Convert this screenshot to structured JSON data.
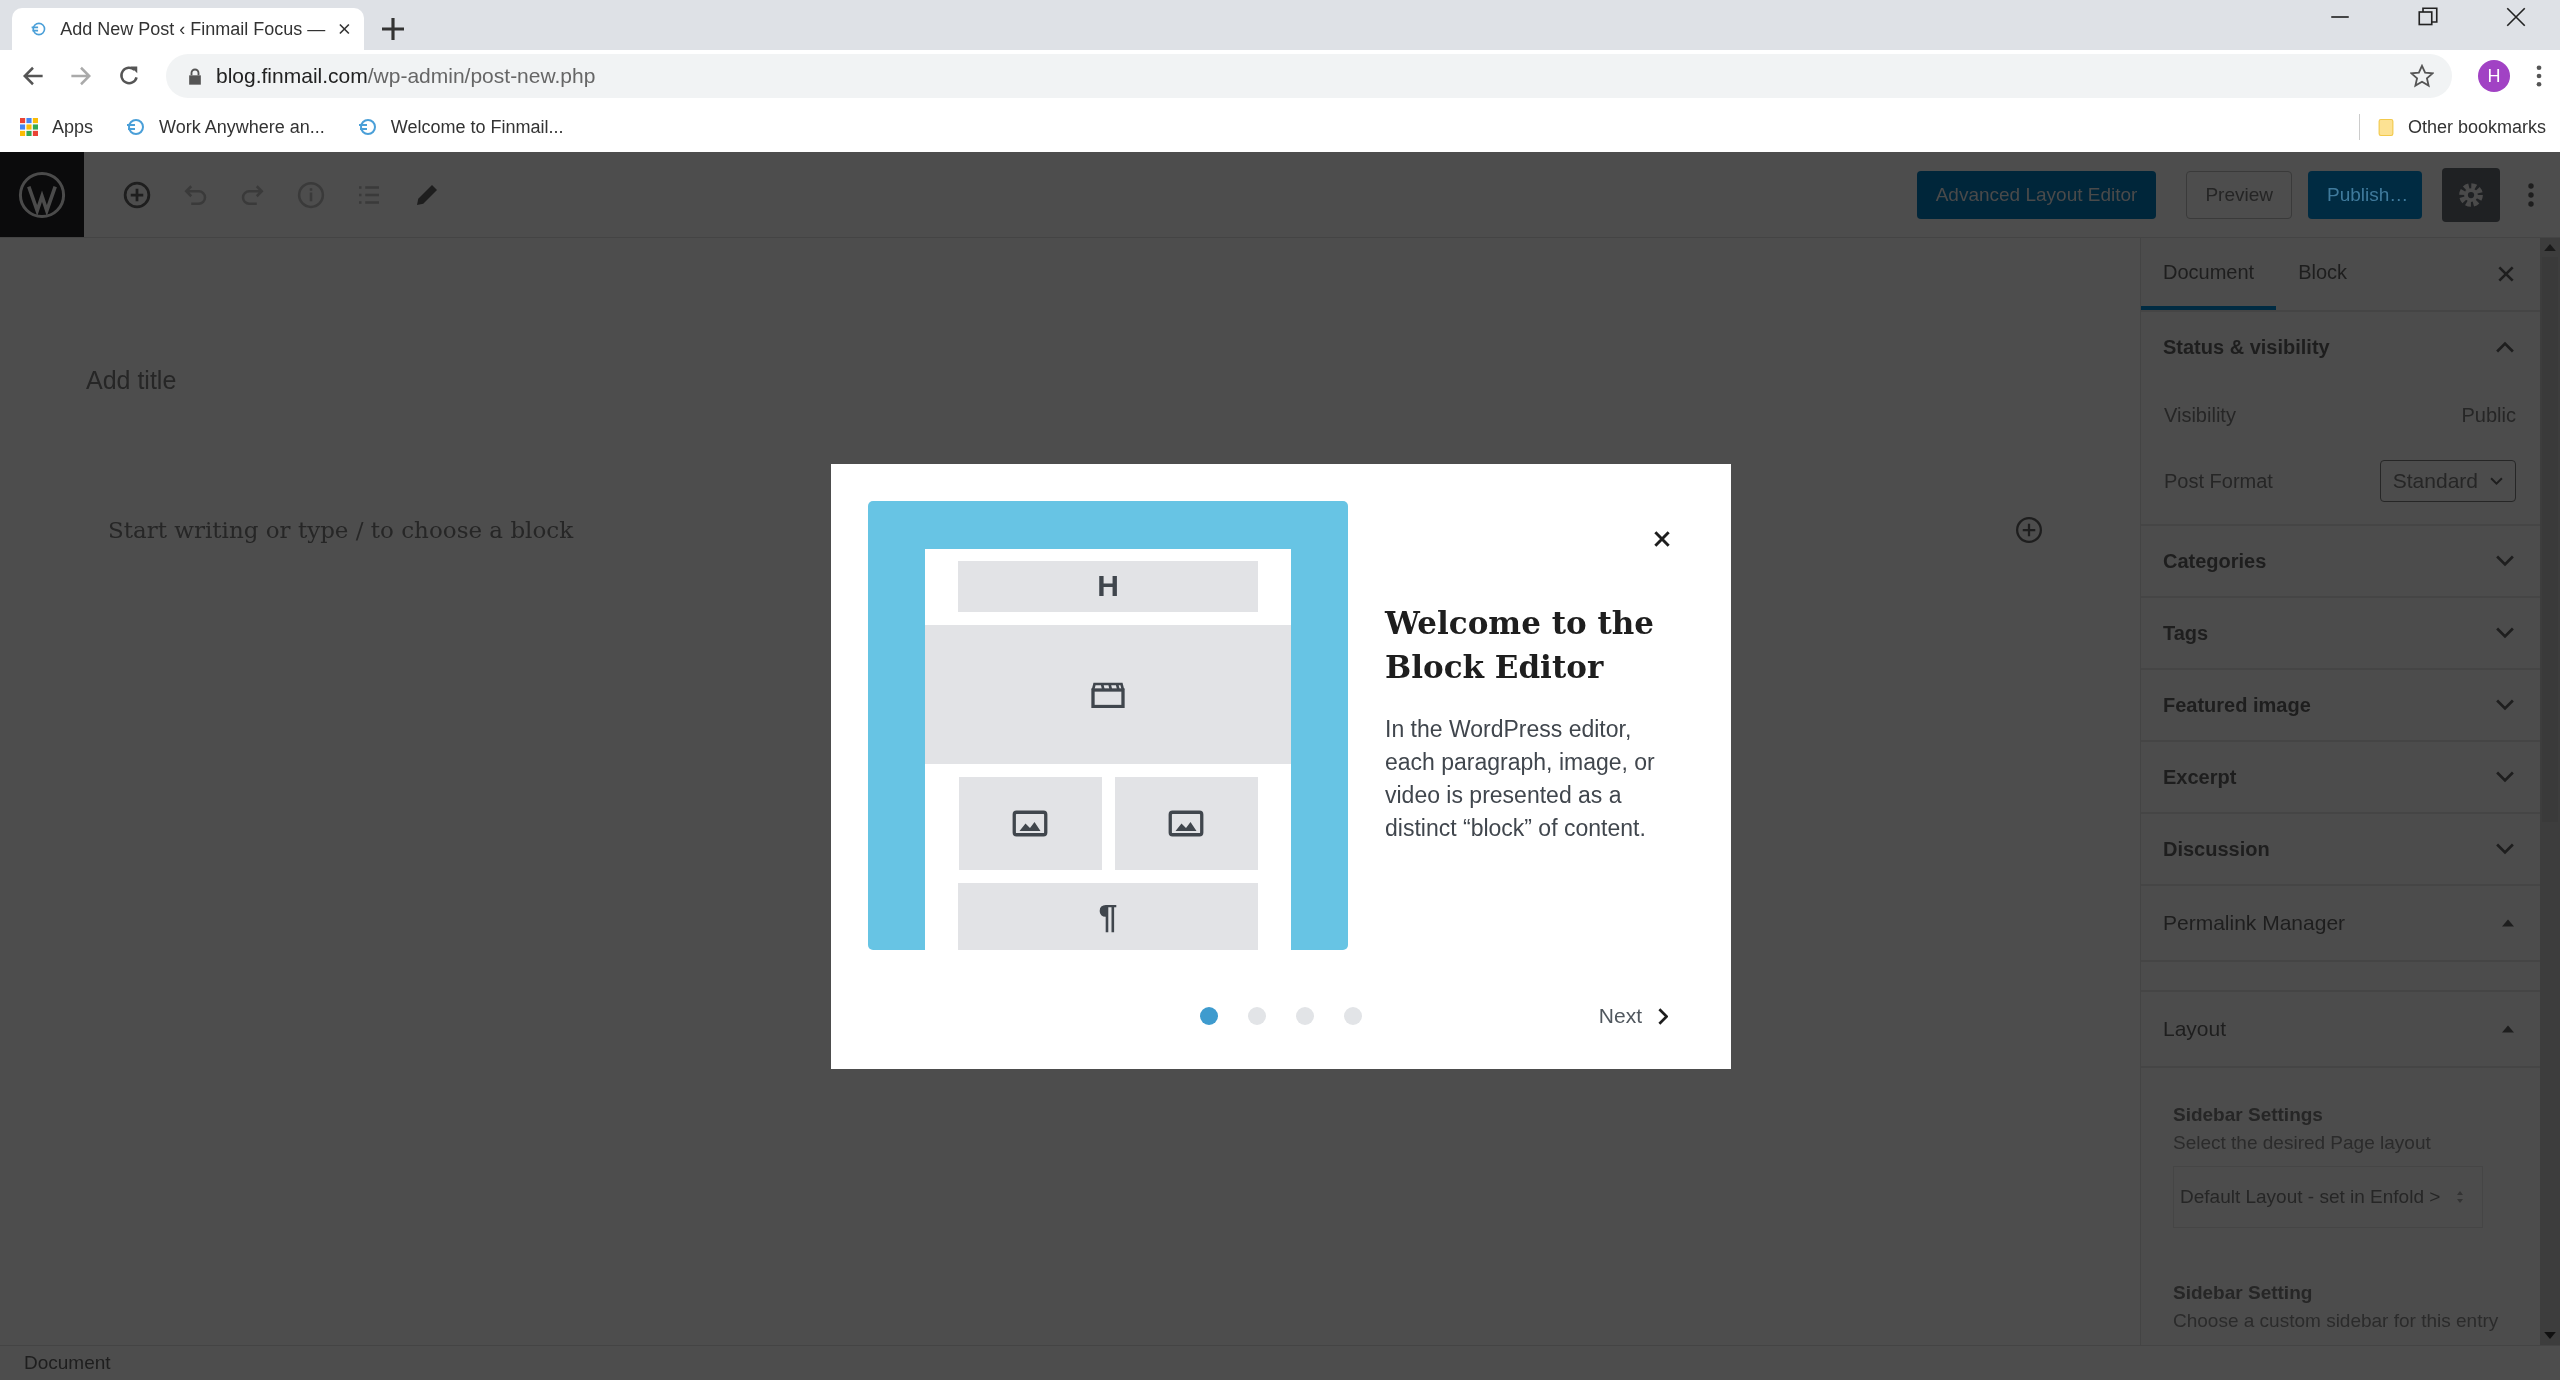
{
  "browser": {
    "tab": {
      "title": "Add New Post ‹ Finmail Focus —",
      "selected": true
    },
    "url": {
      "domain": "blog.finmail.com",
      "path": "/wp-admin/post-new.php"
    },
    "profile_initial": "H",
    "bookmarks": [
      {
        "label": "Apps",
        "kind": "apps"
      },
      {
        "label": "Work Anywhere an...",
        "kind": "site"
      },
      {
        "label": "Welcome to Finmail...",
        "kind": "site"
      }
    ],
    "other_bookmarks": "Other bookmarks"
  },
  "toolbar": {
    "buttons": [
      {
        "label": "Advanced Layout Editor",
        "kind": "primary-dark"
      },
      {
        "label": "Preview",
        "kind": "secondary"
      },
      {
        "label": "Publish…",
        "kind": "primary"
      }
    ],
    "settings_pressed": true
  },
  "editor": {
    "title_placeholder": "Add title",
    "body_placeholder": "Start writing or type / to choose a block"
  },
  "sidebar": {
    "tabs": [
      {
        "label": "Document",
        "selected": true
      },
      {
        "label": "Block",
        "selected": false
      }
    ],
    "panels": [
      {
        "title": "Status & visibility",
        "kind": "panel",
        "expanded": true,
        "rows": [
          {
            "label": "Visibility",
            "value": "Public",
            "kind": "text"
          },
          {
            "label": "Post Format",
            "value": "Standard",
            "kind": "select"
          }
        ]
      },
      {
        "title": "Categories",
        "kind": "panel",
        "expanded": false
      },
      {
        "title": "Tags",
        "kind": "panel",
        "expanded": false
      },
      {
        "title": "Featured image",
        "kind": "panel",
        "expanded": false
      },
      {
        "title": "Excerpt",
        "kind": "panel",
        "expanded": false
      },
      {
        "title": "Discussion",
        "kind": "panel",
        "expanded": false
      },
      {
        "title": "Permalink Manager",
        "kind": "metabox"
      },
      {
        "title": "Layout",
        "kind": "metabox",
        "fields": [
          {
            "title": "Sidebar Settings",
            "description": "Select the desired Page layout",
            "select": "Default Layout - set in Enfold >"
          },
          {
            "title": "Sidebar Setting",
            "description": "Choose a custom sidebar for this entry"
          }
        ]
      }
    ]
  },
  "status_bar": "Document",
  "modal": {
    "blocks": [
      {
        "kind": "heading",
        "label": "H"
      },
      {
        "kind": "video"
      },
      {
        "kind": "images"
      },
      {
        "kind": "paragraph",
        "label": "¶"
      }
    ],
    "heading": "Welcome to the Block Editor",
    "text": "In the WordPress editor, each paragraph, image, or video is presented as a distinct “block” of content.",
    "pages": [
      {
        "selected": true
      },
      {
        "selected": false
      },
      {
        "selected": false
      },
      {
        "selected": false
      }
    ],
    "next": "Next"
  }
}
